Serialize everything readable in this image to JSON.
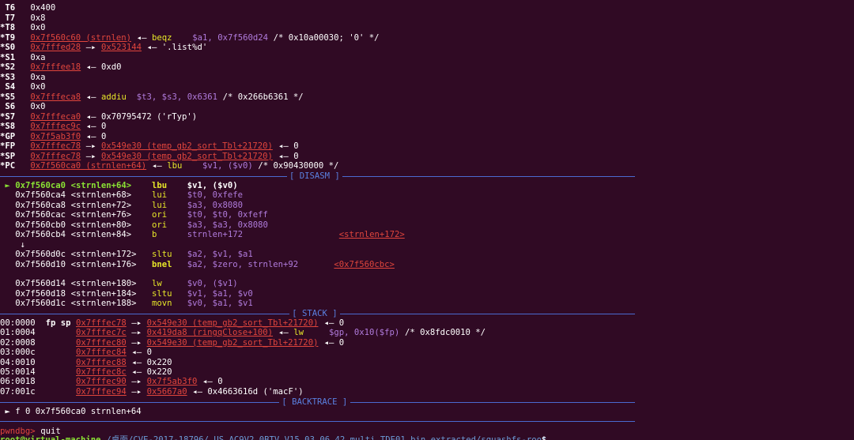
{
  "registers": [
    {
      "mod": "",
      "name": "T6",
      "value": "0x400"
    },
    {
      "mod": "",
      "name": "T7",
      "value": "0x8"
    },
    {
      "mod": "*",
      "name": "T8",
      "value": "0x0"
    },
    {
      "mod": "*",
      "name": "T9",
      "addr": "0x7f560c60 (strnlen)",
      "arrow": "◂—",
      "instr": "beqz",
      "ops_reg": "$a1,",
      "ops_num": "0x7f560d24",
      "comment": "/* 0x10a00030; '0' */"
    },
    {
      "mod": "*",
      "name": "S0",
      "addr": "0x7fffed28",
      "arrow": "—▸",
      "addr2": "0x523144",
      "arrow2": "◂—",
      "tail": "'.list%d'"
    },
    {
      "mod": "*",
      "name": "S1",
      "value": "0xa"
    },
    {
      "mod": "*",
      "name": "S2",
      "addr": "0x7fffee18",
      "arrow": "◂—",
      "tail": "0xd0"
    },
    {
      "mod": "*",
      "name": "S3",
      "value": "0xa"
    },
    {
      "mod": "",
      "name": "S4",
      "value": "0x0"
    },
    {
      "mod": "*",
      "name": "S5",
      "addr": "0x7fffeca8",
      "arrow": "◂—",
      "instr": "addiu",
      "ops_reg": "$t3, $s3,",
      "ops_num": "0x6361",
      "comment": "/* 0x266b6361 */"
    },
    {
      "mod": "",
      "name": "S6",
      "value": "0x0"
    },
    {
      "mod": "*",
      "name": "S7",
      "addr": "0x7fffeca0",
      "arrow": "◂—",
      "tail": "0x70795472 ('rTyp')"
    },
    {
      "mod": "*",
      "name": "S8",
      "addr": "0x7fffec9c",
      "arrow": "◂—",
      "tail": "0"
    },
    {
      "mod": "*",
      "name": "GP",
      "addr": "0x7f5ab3f0",
      "arrow": "◂—",
      "tail": "0"
    },
    {
      "mod": "*",
      "name": "FP",
      "addr": "0x7fffec78",
      "arrow": "—▸",
      "addr2": "0x549e30 (temp_gb2_sort_Tbl+21720)",
      "arrow2": "◂—",
      "tail": "0"
    },
    {
      "mod": "*",
      "name": "SP",
      "addr": "0x7fffec78",
      "arrow": "—▸",
      "addr2": "0x549e30 (temp_gb2_sort_Tbl+21720)",
      "arrow2": "◂—",
      "tail": "0"
    },
    {
      "mod": "*",
      "name": "PC",
      "addr": "0x7f560ca0 (strnlen+64)",
      "arrow": "◂—",
      "instr": "lbu",
      "ops_reg": "$v1, ($v0)",
      "comment": "/* 0x90430000 */"
    }
  ],
  "sections": {
    "disasm": "[ DISASM ]",
    "stack": "[ STACK ]",
    "backtrace": "[ BACKTRACE ]"
  },
  "disasm": [
    {
      "marker": "►",
      "addr": "0x7f560ca0",
      "sym": "<strnlen+64>",
      "mn": "lbu",
      "ops": "$v1, ($v0)",
      "current": true
    },
    {
      "addr": "0x7f560ca4",
      "sym": "<strnlen+68>",
      "mn": "lui",
      "ops": "$t0, 0xfefe"
    },
    {
      "addr": "0x7f560ca8",
      "sym": "<strnlen+72>",
      "mn": "lui",
      "ops": "$a3, 0x8080"
    },
    {
      "addr": "0x7f560cac",
      "sym": "<strnlen+76>",
      "mn": "ori",
      "ops": "$t0, $t0, 0xfeff"
    },
    {
      "addr": "0x7f560cb0",
      "sym": "<strnlen+80>",
      "mn": "ori",
      "ops": "$a3, $a3, 0x8080"
    },
    {
      "addr": "0x7f560cb4",
      "sym": "<strnlen+84>",
      "mn": "b",
      "ops": "strnlen+172",
      "target": "<strnlen+172>"
    },
    {
      "jump": "↓"
    },
    {
      "addr": "0x7f560d0c",
      "sym": "<strnlen+172>",
      "mn": "sltu",
      "ops": "$a2, $v1, $a1"
    },
    {
      "addr": "0x7f560d10",
      "sym": "<strnlen+176>",
      "mn": "bnel",
      "ops": "$a2, $zero, strnlen+92",
      "target": "<0x7f560cbc>"
    },
    {
      "addr": "0x7f560d14",
      "sym": "<strnlen+180>",
      "mn": "lw",
      "ops": "$v0, ($v1)"
    },
    {
      "addr": "0x7f560d18",
      "sym": "<strnlen+184>",
      "mn": "sltu",
      "ops": "$v1, $a1, $v0"
    },
    {
      "addr": "0x7f560d1c",
      "sym": "<strnlen+188>",
      "mn": "movn",
      "ops": "$v0, $a1, $v1"
    }
  ],
  "stack": [
    {
      "idx": "00:0000",
      "regs": "fp sp",
      "addr": "0x7fffec78",
      "arrow": "—▸",
      "addr2": "0x549e30 (temp_gb2_sort_Tbl+21720)",
      "arrow2": "◂—",
      "tail": "0"
    },
    {
      "idx": "01:0004",
      "addr": "0x7fffec7c",
      "arrow": "—▸",
      "addr2": "0x419da8 (ringqClose+100)",
      "arrow2": "◂—",
      "instr": "lw",
      "ops": "$gp, 0x10($fp)",
      "comment": "/* 0x8fdc0010 */"
    },
    {
      "idx": "02:0008",
      "addr": "0x7fffec80",
      "arrow": "—▸",
      "addr2": "0x549e30 (temp_gb2_sort_Tbl+21720)",
      "arrow2": "◂—",
      "tail": "0"
    },
    {
      "idx": "03:000c",
      "addr": "0x7fffec84",
      "arrow": "◂—",
      "tail": "0"
    },
    {
      "idx": "04:0010",
      "addr": "0x7fffec88",
      "arrow": "◂—",
      "tail": "0x220"
    },
    {
      "idx": "05:0014",
      "addr": "0x7fffec8c",
      "arrow": "◂—",
      "tail": "0x220"
    },
    {
      "idx": "06:0018",
      "addr": "0x7fffec90",
      "arrow": "—▸",
      "addr2": "0x7f5ab3f0",
      "arrow2": "◂—",
      "tail": "0"
    },
    {
      "idx": "07:001c",
      "addr": "0x7fffec94",
      "arrow": "—▸",
      "addr2": "0x5667a0",
      "arrow2": "◂—",
      "tail": "0x4663616d ('macF')"
    }
  ],
  "backtrace": {
    "marker": "►",
    "text": "f 0 0x7f560ca0 strnlen+64"
  },
  "prompt": {
    "name": "pwndbg>",
    "command": "quit"
  },
  "shell": {
    "user": "root@virtual-machine",
    "path": "/桌面/CVE-2017-18796/_US_AC9V2.0BTV_V15.03.06.42_multi_TDE01.bin.extracted/squashfs-root",
    "symbol": "$"
  }
}
